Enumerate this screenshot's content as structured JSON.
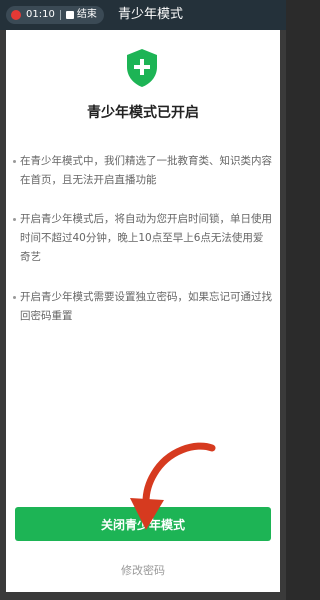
{
  "status_bar": {
    "recording_time": "01:10",
    "stop_label": "结束"
  },
  "header": {
    "title": "青少年模式"
  },
  "main": {
    "heading": "青少年模式已开启",
    "items": [
      "在青少年模式中，我们精选了一批教育类、知识类内容在首页，且无法开启直播功能",
      "开启青少年模式后，将自动为您开启时间锁，单日使用时间不超过40分钟，晚上10点至早上6点无法使用爱奇艺",
      "开启青少年模式需要设置独立密码，如果忘记可通过找回密码重置"
    ],
    "close_button": "关闭青少年模式",
    "change_password": "修改密码"
  },
  "colors": {
    "accent_green": "#1db455",
    "shield_green": "#1db455",
    "arrow_red": "#d63a1f",
    "topbar_bg": "#24313a"
  },
  "icons": [
    "record-dot-icon",
    "stop-icon",
    "shield-plus-icon",
    "red-arrow-annotation"
  ]
}
